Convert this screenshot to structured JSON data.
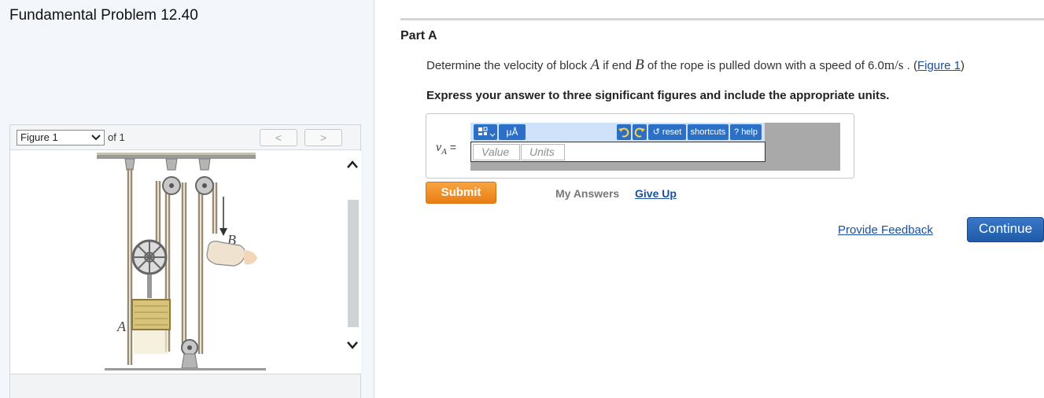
{
  "problem": {
    "title": "Fundamental Problem 12.40"
  },
  "figure_panel": {
    "select_value": "Figure 1",
    "of_text": "of 1",
    "prev_label": "<",
    "next_label": ">",
    "scroll_up_icon": "chevron-up-icon",
    "scroll_down_icon": "chevron-down-icon",
    "diagram": {
      "label_a": "A",
      "label_b": "B"
    }
  },
  "part": {
    "label": "Part A",
    "question": {
      "text_1": "Determine the velocity of block ",
      "var_a": "A",
      "text_2": " if end ",
      "var_b": "B",
      "text_3": " of the rope is pulled down with a speed of ",
      "speed": "6.0",
      "unit": "m/s",
      "text_4": " . (",
      "figure_link": "Figure 1",
      "text_5": ")"
    },
    "instruction": "Express your answer to three significant figures and include the appropriate units."
  },
  "answer": {
    "variable": "v",
    "subscript": "A",
    "equals": "=",
    "toolbar": {
      "templates_icon": "templates-icon",
      "units_label": "μÅ",
      "reset": "reset",
      "shortcuts": "shortcuts",
      "help": "help"
    },
    "value_placeholder": "Value",
    "units_placeholder": "Units"
  },
  "actions": {
    "submit": "Submit",
    "my_answers": "My Answers",
    "give_up": "Give Up",
    "provide_feedback": "Provide Feedback",
    "continue": "Continue"
  },
  "colors": {
    "submit_orange": "#ef8a1e",
    "continue_blue": "#2a67b8",
    "link_blue": "#1a4fa0",
    "toolbar_blue": "#2c6fc6"
  }
}
